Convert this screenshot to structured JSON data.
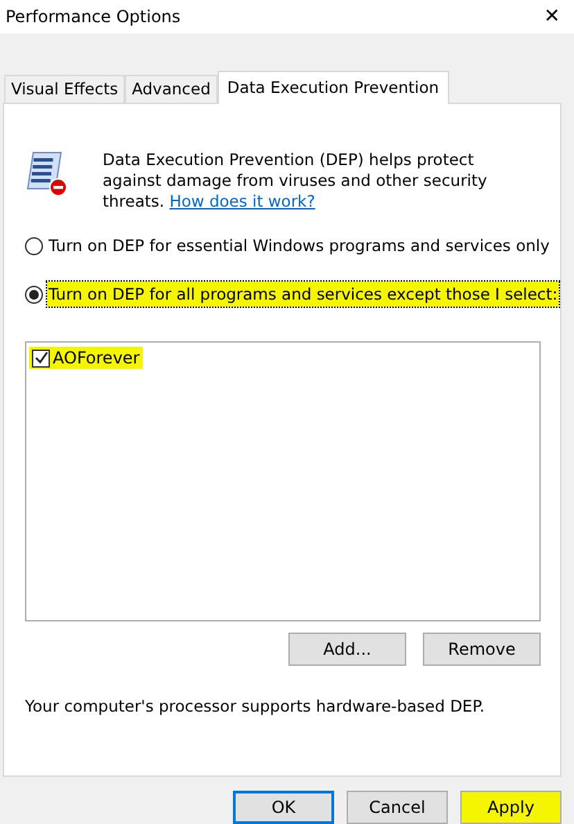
{
  "window": {
    "title": "Performance Options",
    "close": "✕"
  },
  "tabs": [
    {
      "label": "Visual Effects",
      "selected": false
    },
    {
      "label": "Advanced",
      "selected": false
    },
    {
      "label": "Data Execution Prevention",
      "selected": true
    }
  ],
  "intro": {
    "text": "Data Execution Prevention (DEP) helps protect against damage from viruses and other security threats.",
    "link": "How does it work?"
  },
  "options": [
    {
      "label": "Turn on DEP for essential Windows programs and services only",
      "selected": false,
      "highlighted": false
    },
    {
      "label": "Turn on DEP for all programs and services except those I select:",
      "selected": true,
      "highlighted": true
    }
  ],
  "programs": [
    {
      "name": "AOForever",
      "checked": true,
      "highlighted": true
    }
  ],
  "list_buttons": [
    {
      "label": "Add...",
      "highlighted": false
    },
    {
      "label": "Remove",
      "highlighted": false
    }
  ],
  "support_note": "Your computer's processor supports hardware-based DEP.",
  "buttons": [
    {
      "label": "OK",
      "default": true,
      "highlighted": false
    },
    {
      "label": "Cancel",
      "default": false,
      "highlighted": false
    },
    {
      "label": "Apply",
      "default": false,
      "highlighted": true
    }
  ]
}
